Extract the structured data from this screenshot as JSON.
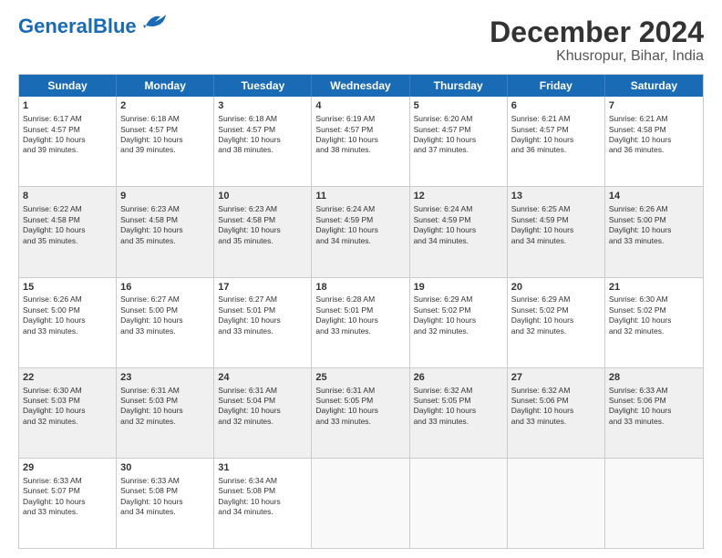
{
  "logo": {
    "line1": "General",
    "line2": "Blue"
  },
  "title": "December 2024",
  "subtitle": "Khusropur, Bihar, India",
  "days": [
    "Sunday",
    "Monday",
    "Tuesday",
    "Wednesday",
    "Thursday",
    "Friday",
    "Saturday"
  ],
  "weeks": [
    [
      {
        "day": "1",
        "info": "Sunrise: 6:17 AM\nSunset: 4:57 PM\nDaylight: 10 hours\nand 39 minutes."
      },
      {
        "day": "2",
        "info": "Sunrise: 6:18 AM\nSunset: 4:57 PM\nDaylight: 10 hours\nand 39 minutes."
      },
      {
        "day": "3",
        "info": "Sunrise: 6:18 AM\nSunset: 4:57 PM\nDaylight: 10 hours\nand 38 minutes."
      },
      {
        "day": "4",
        "info": "Sunrise: 6:19 AM\nSunset: 4:57 PM\nDaylight: 10 hours\nand 38 minutes."
      },
      {
        "day": "5",
        "info": "Sunrise: 6:20 AM\nSunset: 4:57 PM\nDaylight: 10 hours\nand 37 minutes."
      },
      {
        "day": "6",
        "info": "Sunrise: 6:21 AM\nSunset: 4:57 PM\nDaylight: 10 hours\nand 36 minutes."
      },
      {
        "day": "7",
        "info": "Sunrise: 6:21 AM\nSunset: 4:58 PM\nDaylight: 10 hours\nand 36 minutes."
      }
    ],
    [
      {
        "day": "8",
        "info": "Sunrise: 6:22 AM\nSunset: 4:58 PM\nDaylight: 10 hours\nand 35 minutes."
      },
      {
        "day": "9",
        "info": "Sunrise: 6:23 AM\nSunset: 4:58 PM\nDaylight: 10 hours\nand 35 minutes."
      },
      {
        "day": "10",
        "info": "Sunrise: 6:23 AM\nSunset: 4:58 PM\nDaylight: 10 hours\nand 35 minutes."
      },
      {
        "day": "11",
        "info": "Sunrise: 6:24 AM\nSunset: 4:59 PM\nDaylight: 10 hours\nand 34 minutes."
      },
      {
        "day": "12",
        "info": "Sunrise: 6:24 AM\nSunset: 4:59 PM\nDaylight: 10 hours\nand 34 minutes."
      },
      {
        "day": "13",
        "info": "Sunrise: 6:25 AM\nSunset: 4:59 PM\nDaylight: 10 hours\nand 34 minutes."
      },
      {
        "day": "14",
        "info": "Sunrise: 6:26 AM\nSunset: 5:00 PM\nDaylight: 10 hours\nand 33 minutes."
      }
    ],
    [
      {
        "day": "15",
        "info": "Sunrise: 6:26 AM\nSunset: 5:00 PM\nDaylight: 10 hours\nand 33 minutes."
      },
      {
        "day": "16",
        "info": "Sunrise: 6:27 AM\nSunset: 5:00 PM\nDaylight: 10 hours\nand 33 minutes."
      },
      {
        "day": "17",
        "info": "Sunrise: 6:27 AM\nSunset: 5:01 PM\nDaylight: 10 hours\nand 33 minutes."
      },
      {
        "day": "18",
        "info": "Sunrise: 6:28 AM\nSunset: 5:01 PM\nDaylight: 10 hours\nand 33 minutes."
      },
      {
        "day": "19",
        "info": "Sunrise: 6:29 AM\nSunset: 5:02 PM\nDaylight: 10 hours\nand 32 minutes."
      },
      {
        "day": "20",
        "info": "Sunrise: 6:29 AM\nSunset: 5:02 PM\nDaylight: 10 hours\nand 32 minutes."
      },
      {
        "day": "21",
        "info": "Sunrise: 6:30 AM\nSunset: 5:02 PM\nDaylight: 10 hours\nand 32 minutes."
      }
    ],
    [
      {
        "day": "22",
        "info": "Sunrise: 6:30 AM\nSunset: 5:03 PM\nDaylight: 10 hours\nand 32 minutes."
      },
      {
        "day": "23",
        "info": "Sunrise: 6:31 AM\nSunset: 5:03 PM\nDaylight: 10 hours\nand 32 minutes."
      },
      {
        "day": "24",
        "info": "Sunrise: 6:31 AM\nSunset: 5:04 PM\nDaylight: 10 hours\nand 32 minutes."
      },
      {
        "day": "25",
        "info": "Sunrise: 6:31 AM\nSunset: 5:05 PM\nDaylight: 10 hours\nand 33 minutes."
      },
      {
        "day": "26",
        "info": "Sunrise: 6:32 AM\nSunset: 5:05 PM\nDaylight: 10 hours\nand 33 minutes."
      },
      {
        "day": "27",
        "info": "Sunrise: 6:32 AM\nSunset: 5:06 PM\nDaylight: 10 hours\nand 33 minutes."
      },
      {
        "day": "28",
        "info": "Sunrise: 6:33 AM\nSunset: 5:06 PM\nDaylight: 10 hours\nand 33 minutes."
      }
    ],
    [
      {
        "day": "29",
        "info": "Sunrise: 6:33 AM\nSunset: 5:07 PM\nDaylight: 10 hours\nand 33 minutes."
      },
      {
        "day": "30",
        "info": "Sunrise: 6:33 AM\nSunset: 5:08 PM\nDaylight: 10 hours\nand 34 minutes."
      },
      {
        "day": "31",
        "info": "Sunrise: 6:34 AM\nSunset: 5:08 PM\nDaylight: 10 hours\nand 34 minutes."
      },
      {
        "day": "",
        "info": ""
      },
      {
        "day": "",
        "info": ""
      },
      {
        "day": "",
        "info": ""
      },
      {
        "day": "",
        "info": ""
      }
    ]
  ]
}
